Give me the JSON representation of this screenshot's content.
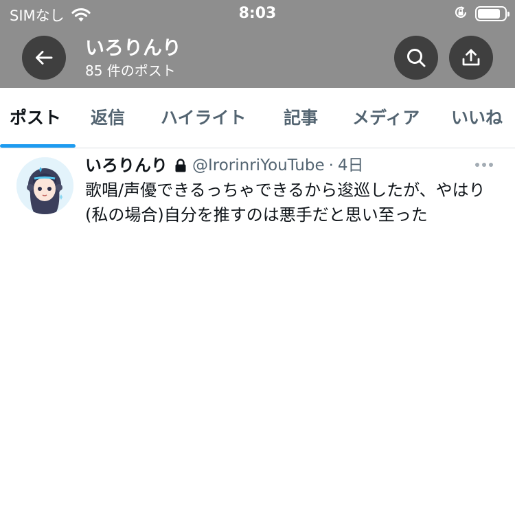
{
  "status_bar": {
    "carrier": "SIMなし",
    "time": "8:03"
  },
  "header": {
    "profile_name": "いろりんり",
    "post_count": "85 件のポスト"
  },
  "tabs": [
    {
      "label": "ポスト",
      "active": true
    },
    {
      "label": "返信",
      "active": false
    },
    {
      "label": "ハイライト",
      "active": false
    },
    {
      "label": "記事",
      "active": false
    },
    {
      "label": "メディア",
      "active": false
    },
    {
      "label": "いいね",
      "active": false
    }
  ],
  "tweet": {
    "author_name": "いろりんり",
    "handle": "@IrorinriYouTube",
    "separator": "·",
    "time": "4日",
    "text": "歌唱/声優できるっちゃできるから逡巡したが、やはり(私の場合)自分を推すのは悪手だと思い至った"
  },
  "colors": {
    "header_bg": "#8e8e8e",
    "button_bg": "#3f3f3f",
    "accent": "#1d9bf0",
    "secondary_text": "#536471"
  },
  "icons": {
    "back": "arrow-left-icon",
    "search": "search-icon",
    "share": "share-icon",
    "lock": "lock-icon",
    "more": "more-icon",
    "wifi": "wifi-icon",
    "battery": "battery-icon",
    "orientation_lock": "orientation-lock-icon"
  },
  "battery_level": 0.85
}
